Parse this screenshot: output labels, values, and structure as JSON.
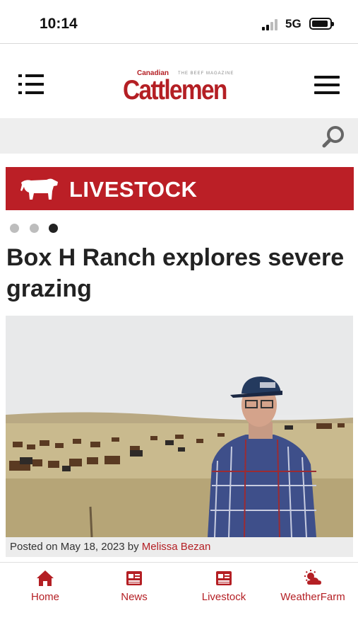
{
  "status": {
    "time": "10:14",
    "network": "5G"
  },
  "header": {
    "logo_top": "Canadian",
    "logo_tagline": "THE BEEF MAGAZINE",
    "logo_main": "Cattlemen"
  },
  "search": {
    "placeholder": "",
    "value": ""
  },
  "category": {
    "label": "LIVESTOCK"
  },
  "carousel": {
    "total": 3,
    "active_index": 2
  },
  "article": {
    "headline": "Box H Ranch explores severe grazing",
    "posted_prefix": "Posted on May 18, 2023 by ",
    "author": "Melissa Bezan"
  },
  "bottom_nav": {
    "items": [
      {
        "label": "Home",
        "icon": "home-icon"
      },
      {
        "label": "News",
        "icon": "news-icon"
      },
      {
        "label": "Livestock",
        "icon": "livestock-icon"
      },
      {
        "label": "WeatherFarm",
        "icon": "weather-icon"
      }
    ]
  },
  "colors": {
    "brand_red": "#b41f24",
    "banner_red": "#bb1f26"
  }
}
